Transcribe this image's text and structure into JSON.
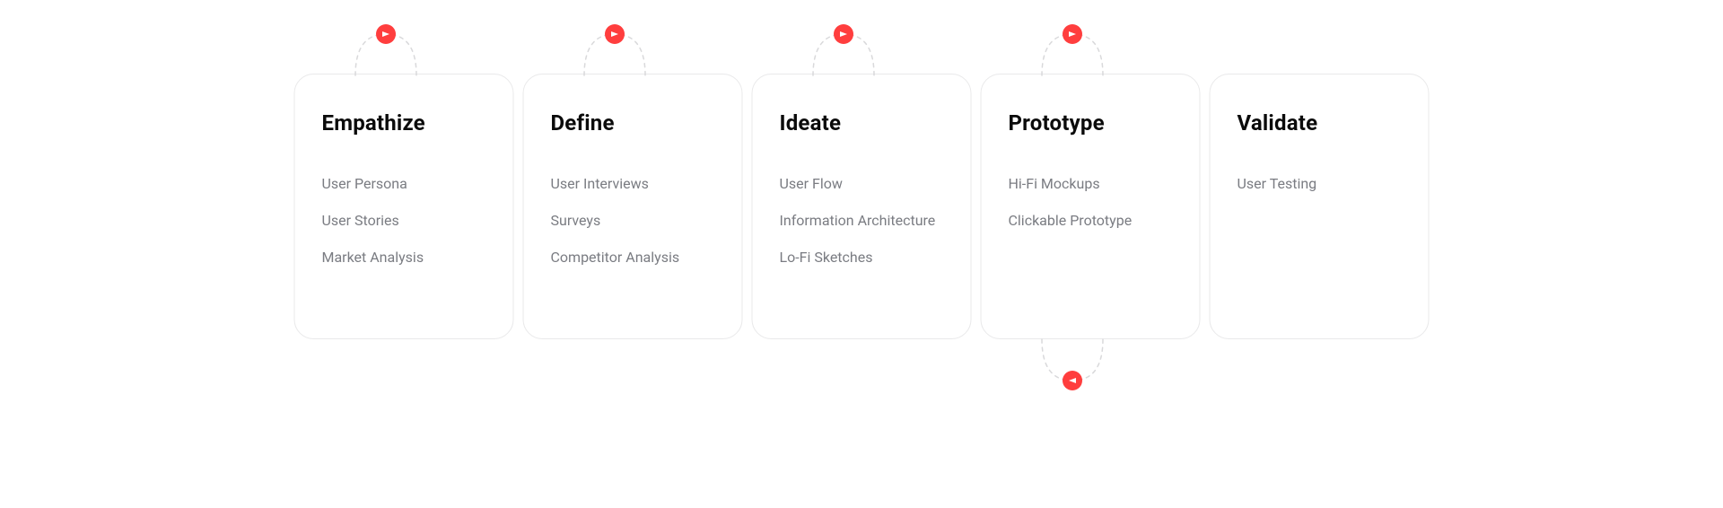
{
  "colors": {
    "accent": "#FF3E3E",
    "card_border": "#E9E9EA",
    "text_heading": "#0B0B0B",
    "text_item": "#7A7C82"
  },
  "steps": [
    {
      "title": "Empathize",
      "items": [
        "User Persona",
        "User Stories",
        "Market Analysis"
      ]
    },
    {
      "title": "Define",
      "items": [
        "User Interviews",
        "Surveys",
        "Competitor Analysis"
      ]
    },
    {
      "title": "Ideate",
      "items": [
        "User Flow",
        "Information Architecture",
        "Lo-Fi Sketches"
      ]
    },
    {
      "title": "Prototype",
      "items": [
        "Hi-Fi Mockups",
        "Clickable Prototype"
      ]
    },
    {
      "title": "Validate",
      "items": [
        "User Testing"
      ]
    }
  ],
  "connectors": {
    "top_direction": "right",
    "bottom_direction": "left"
  }
}
